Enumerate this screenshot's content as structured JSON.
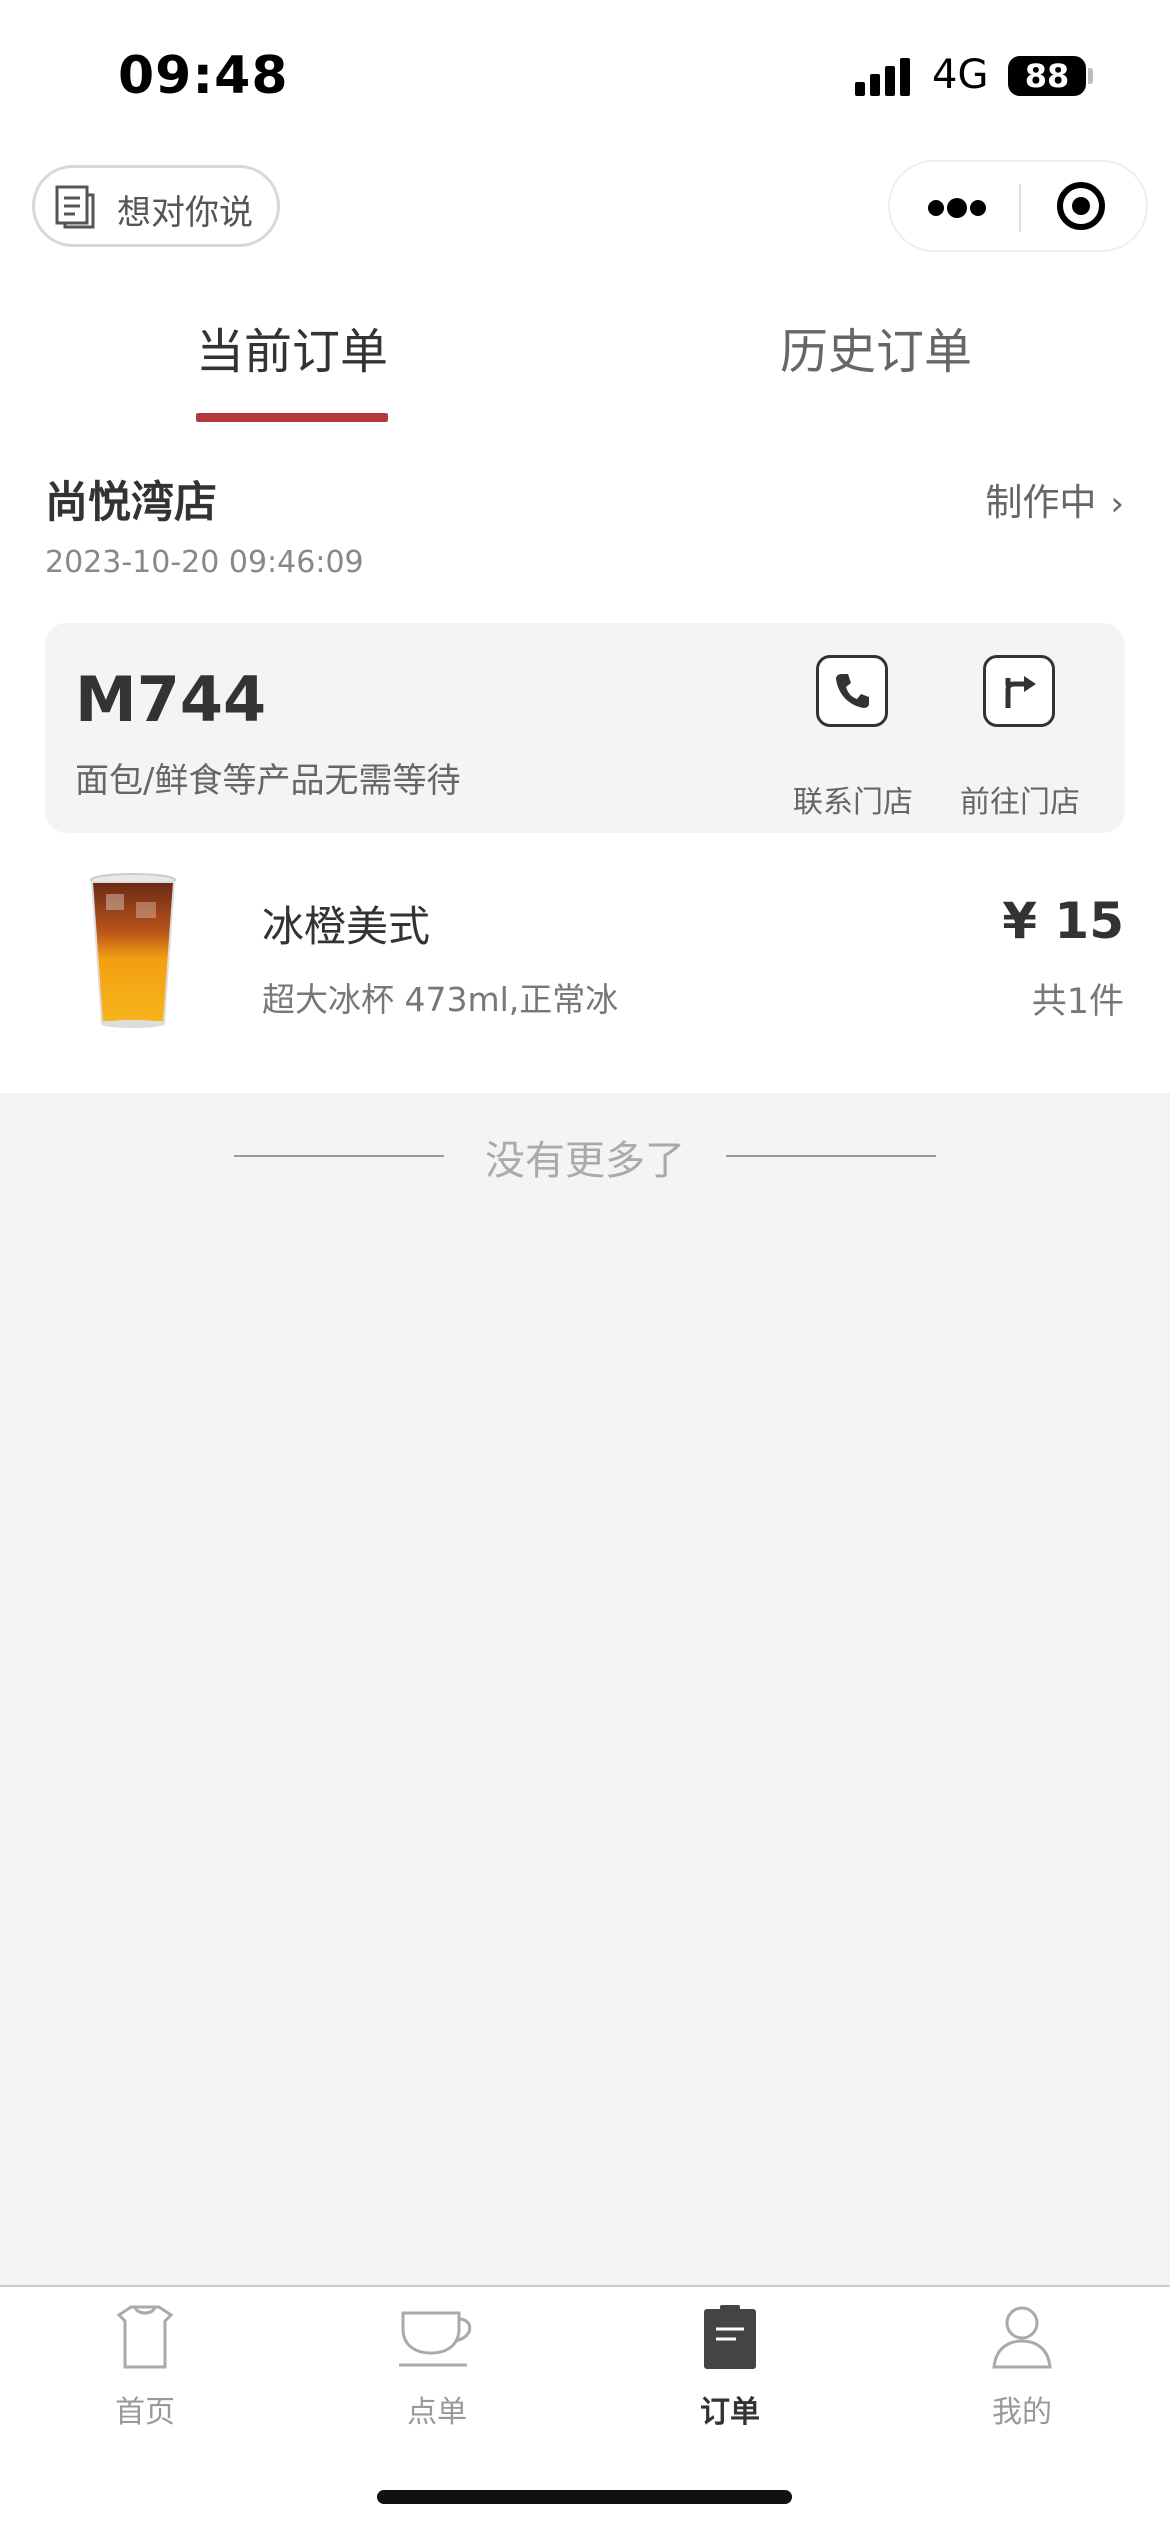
{
  "status_bar": {
    "time": "09:48",
    "network": "4G",
    "battery": "88"
  },
  "mini_program": {
    "feedback_label": "想对你说"
  },
  "tabs": [
    {
      "label": "当前订单",
      "active": true
    },
    {
      "label": "历史订单",
      "active": false
    }
  ],
  "order": {
    "store_name": "尚悦湾店",
    "time": "2023-10-20 09:46:09",
    "status": "制作中",
    "pickup_code": "M744",
    "pickup_note": "面包/鲜食等产品无需等待",
    "actions": {
      "call_label": "联系门店",
      "navigate_label": "前往门店"
    },
    "item": {
      "name": "冰橙美式",
      "spec": "超大冰杯 473ml,正常冰",
      "price": "¥ 15",
      "quantity": "共1件"
    }
  },
  "list_end_text": "没有更多了",
  "tabbar": [
    {
      "label": "首页",
      "icon": "shirt-icon",
      "active": false
    },
    {
      "label": "点单",
      "icon": "cup-icon",
      "active": false
    },
    {
      "label": "订单",
      "icon": "clipboard-icon",
      "active": true
    },
    {
      "label": "我的",
      "icon": "person-icon",
      "active": false
    }
  ],
  "colors": {
    "accent": "#b3393c",
    "background": "#f4f4f4"
  }
}
